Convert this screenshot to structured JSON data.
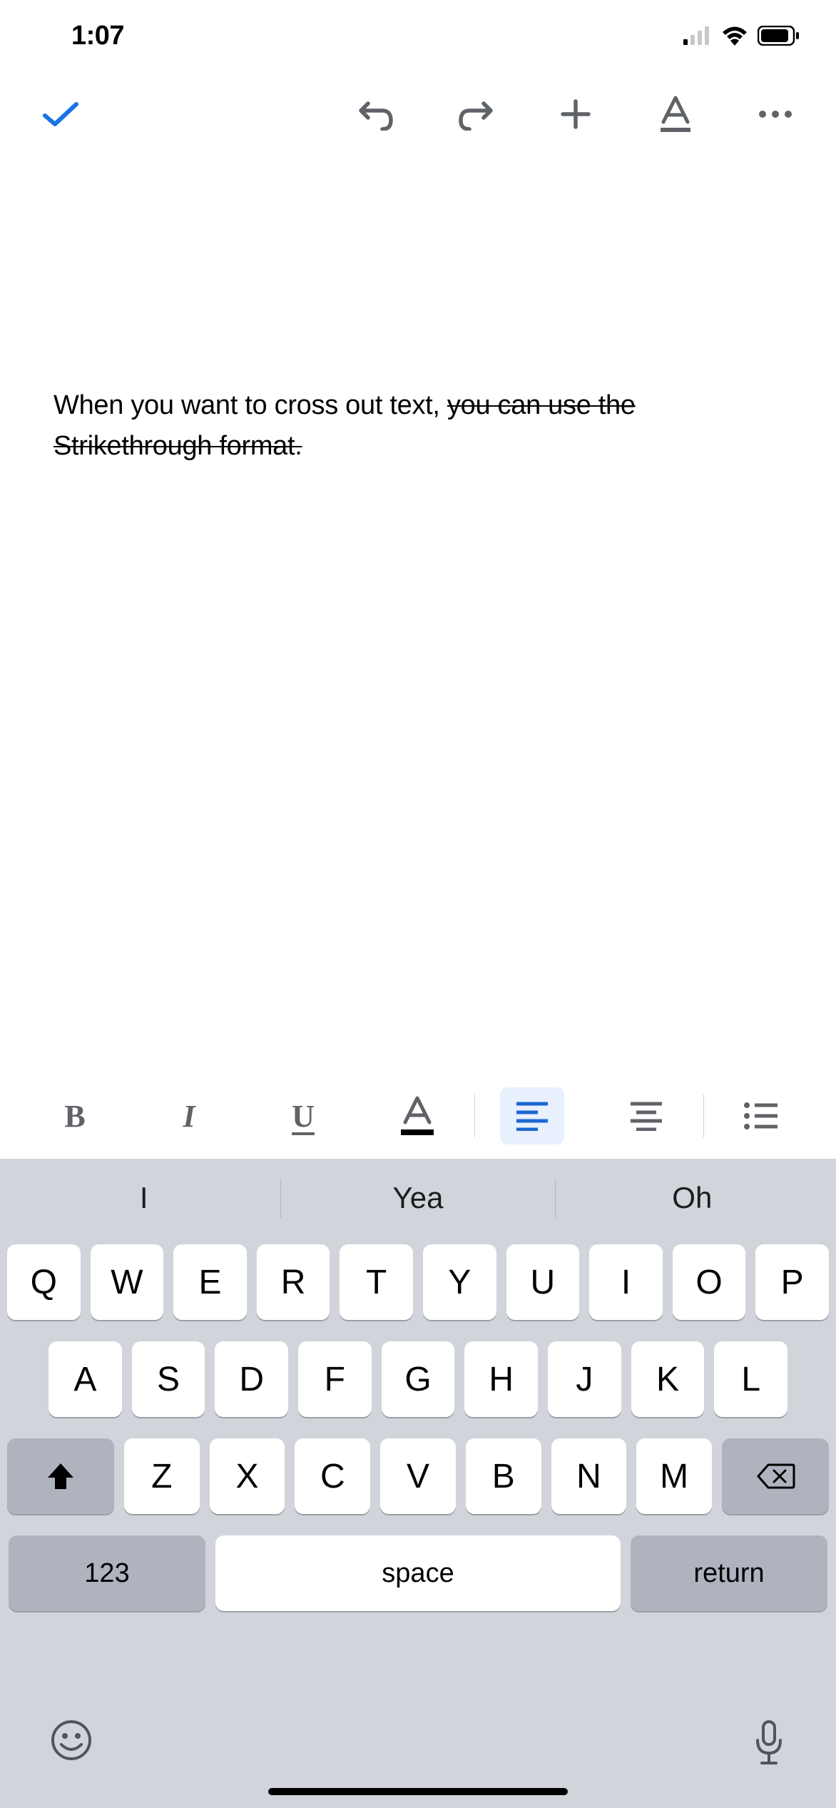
{
  "status": {
    "time": "1:07"
  },
  "toolbar": {
    "done": "done",
    "undo": "undo",
    "redo": "redo",
    "insert": "insert",
    "text_format": "text-format",
    "more": "more"
  },
  "document": {
    "text_plain": "When you want to cross out text, ",
    "text_struck": "you can use the Strikethrough format."
  },
  "format_bar": {
    "bold": "B",
    "italic": "I",
    "underline": "U",
    "text_color": "A",
    "align_left": "align-left",
    "align_center": "align-center",
    "bullets": "bulleted-list",
    "active": "align_left"
  },
  "keyboard": {
    "suggestions": [
      "I",
      "Yea",
      "Oh"
    ],
    "row1": [
      "Q",
      "W",
      "E",
      "R",
      "T",
      "Y",
      "U",
      "I",
      "O",
      "P"
    ],
    "row2": [
      "A",
      "S",
      "D",
      "F",
      "G",
      "H",
      "J",
      "K",
      "L"
    ],
    "row3": [
      "Z",
      "X",
      "C",
      "V",
      "B",
      "N",
      "M"
    ],
    "key_123": "123",
    "key_space": "space",
    "key_return": "return"
  }
}
